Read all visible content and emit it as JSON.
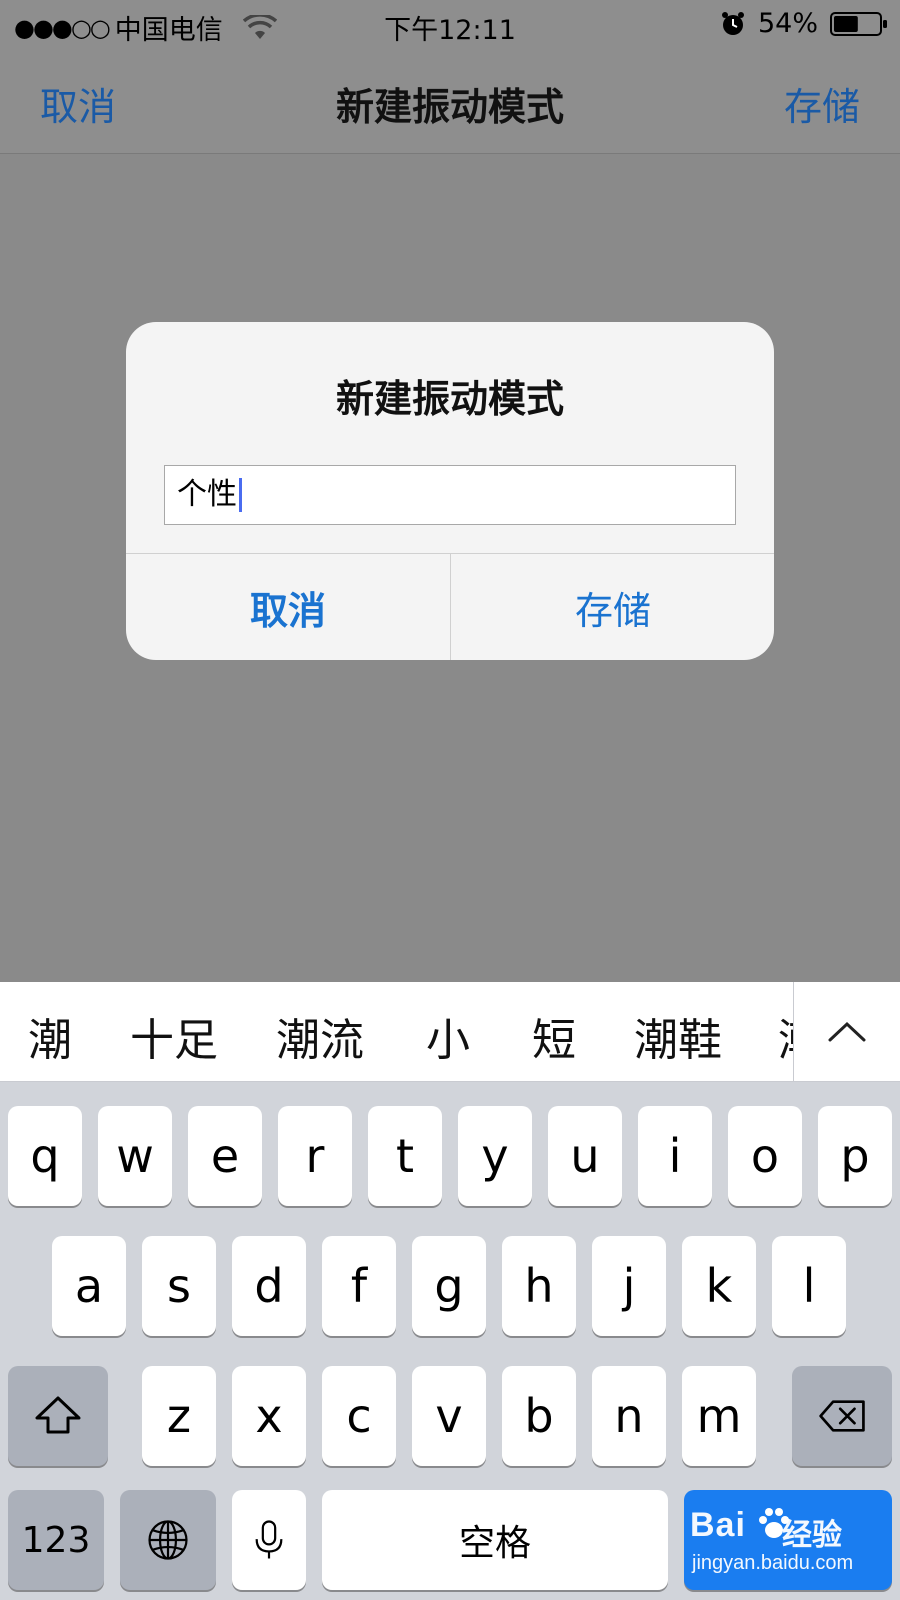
{
  "status_bar": {
    "signal": "●●●○○",
    "carrier": "中国电信",
    "time": "下午12:11",
    "battery_percent": "54%",
    "battery_level": 0.54
  },
  "nav": {
    "cancel": "取消",
    "title": "新建振动模式",
    "save": "存储"
  },
  "alert": {
    "title": "新建振动模式",
    "input_value": "个性",
    "cancel": "取消",
    "save": "存储"
  },
  "candidates": [
    "潮",
    "十足",
    "潮流",
    "小",
    "短",
    "潮鞋",
    "潮"
  ],
  "keyboard": {
    "row1": [
      "q",
      "w",
      "e",
      "r",
      "t",
      "y",
      "u",
      "i",
      "o",
      "p"
    ],
    "row2": [
      "a",
      "s",
      "d",
      "f",
      "g",
      "h",
      "j",
      "k",
      "l"
    ],
    "row3": [
      "z",
      "x",
      "c",
      "v",
      "b",
      "n",
      "m"
    ],
    "numbers": "123",
    "space": "空格",
    "icons": [
      "shift-icon",
      "backspace-icon",
      "globe-icon",
      "microphone-icon"
    ]
  },
  "watermark": {
    "brand": "Bai",
    "sub": "经验",
    "url": "jingyan.baidu.com"
  },
  "colors": {
    "ios_blue": "#1a5aa6",
    "alert_blue": "#1a73d0",
    "keyboard_bg": "#d1d4da"
  }
}
